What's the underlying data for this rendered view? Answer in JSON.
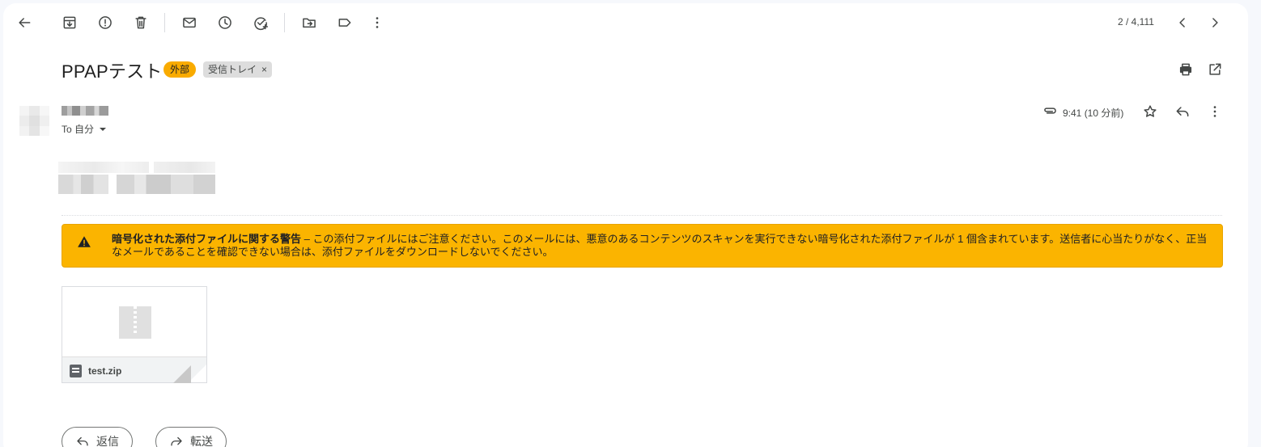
{
  "toolbar": {
    "counter": "2 / 4,111"
  },
  "message": {
    "subject": "PPAPテスト",
    "labels": {
      "external": "外部",
      "inbox": "受信トレイ",
      "remove": "×"
    },
    "to_label": "To 自分",
    "time": "9:41 (10 分前)"
  },
  "warning": {
    "title": "暗号化された添付ファイルに関する警告",
    "separator": " – ",
    "body": "この添付ファイルにはご注意ください。このメールには、悪意のあるコンテンツのスキャンを実行できない暗号化された添付ファイルが 1 個含まれています。送信者に心当たりがなく、正当なメールであることを確認できない場合は、添付ファイルをダウンロードしないでください。"
  },
  "attachment": {
    "filename": "test.zip"
  },
  "actions": {
    "reply": "返信",
    "forward": "転送"
  },
  "colors": {
    "warning_bg": "#fbb400",
    "external_label": "#f9ab00"
  }
}
